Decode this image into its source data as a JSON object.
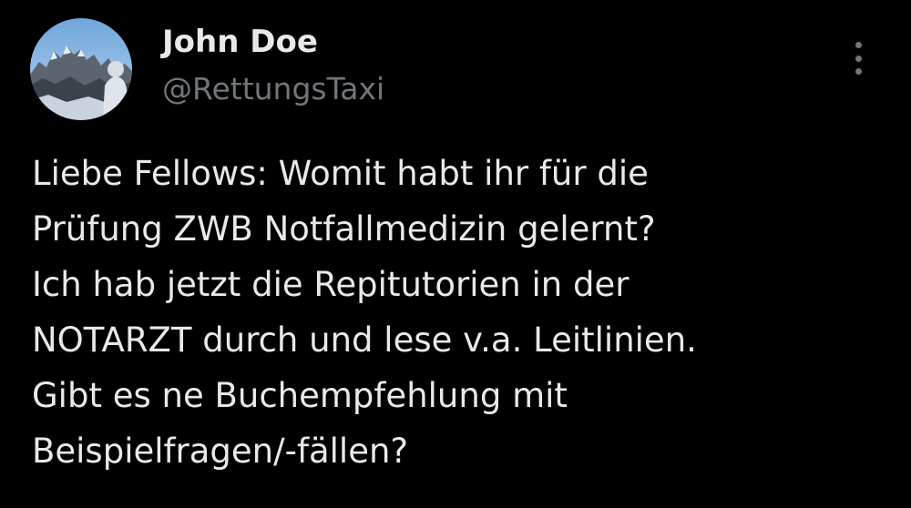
{
  "author": {
    "display_name": "John Doe",
    "handle": "@RettungsTaxi",
    "avatar": "mountain-landscape-avatar"
  },
  "menu": {
    "icon": "more-vertical-icon"
  },
  "tweet": {
    "lines": [
      "Liebe Fellows: Womit habt ihr für die",
      "Prüfung ZWB Notfallmedizin gelernt?",
      "Ich hab jetzt die Repitutorien in der",
      "NOTARZT durch und lese v.a. Leitlinien.",
      "Gibt es ne Buchempfehlung mit",
      "Beispielfragen/-fällen?"
    ]
  },
  "colors": {
    "background": "#000000",
    "text_primary": "#e7e9ea",
    "text_secondary": "#71767b"
  }
}
